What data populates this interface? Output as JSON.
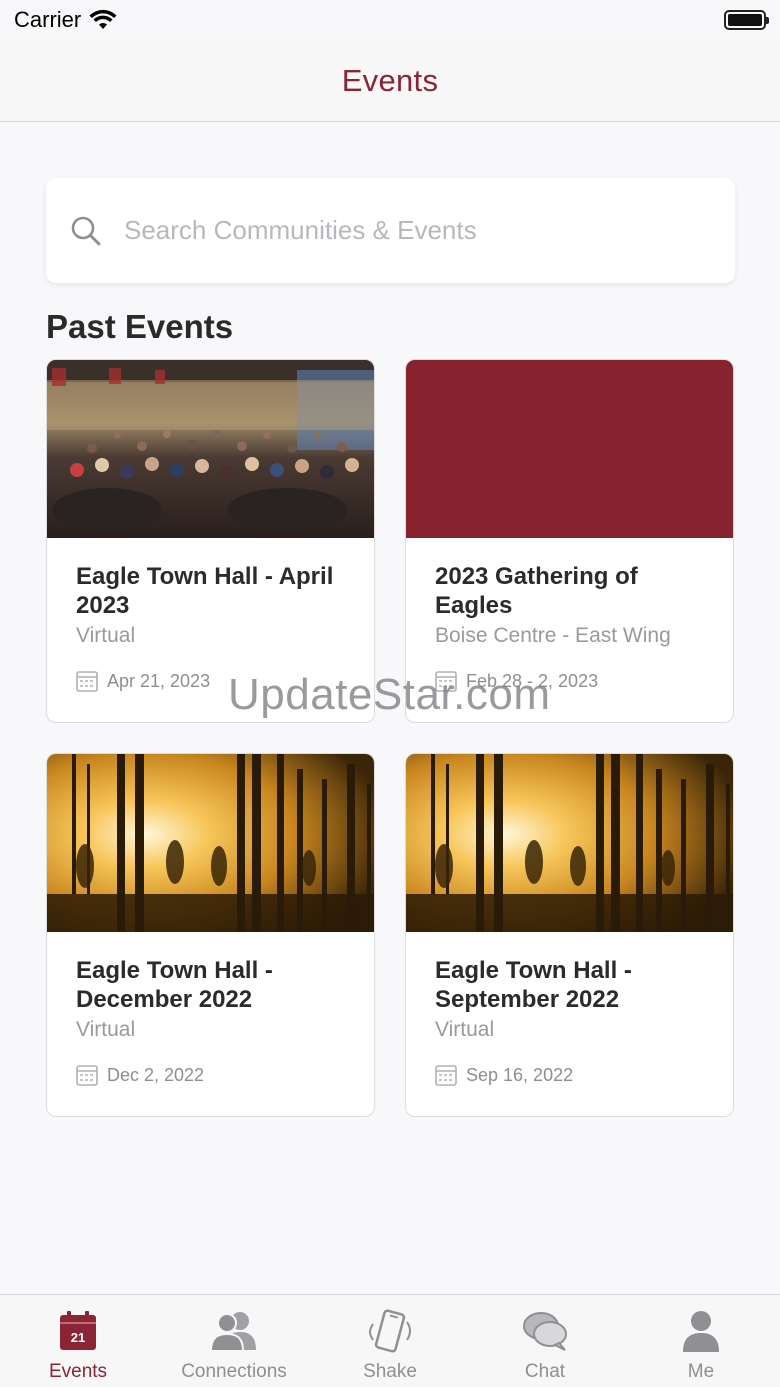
{
  "status_bar": {
    "carrier": "Carrier"
  },
  "nav": {
    "title": "Events"
  },
  "search": {
    "placeholder": "Search Communities & Events",
    "value": ""
  },
  "section": {
    "title": "Past Events"
  },
  "events": [
    {
      "title": "Eagle Town Hall - April 2023",
      "location": "Virtual",
      "date": "Apr 21, 2023",
      "image": "banquet-hall-photo"
    },
    {
      "title": "2023 Gathering of Eagles",
      "location": "Boise Centre - East Wing",
      "date": "Feb 28 - 2, 2023",
      "image": "solid-maroon-placeholder"
    },
    {
      "title": "Eagle Town Hall - December 2022",
      "location": "Virtual",
      "date": "Dec  2, 2022",
      "image": "sunset-power-poles-photo"
    },
    {
      "title": "Eagle Town Hall - September 2022",
      "location": "Virtual",
      "date": "Sep 16, 2022",
      "image": "sunset-power-poles-photo"
    }
  ],
  "watermark": "UpdateStar.com",
  "tabs": [
    {
      "label": "Events",
      "icon": "calendar-icon",
      "badge": "21",
      "active": true
    },
    {
      "label": "Connections",
      "icon": "people-icon",
      "active": false
    },
    {
      "label": "Shake",
      "icon": "shake-phone-icon",
      "active": false
    },
    {
      "label": "Chat",
      "icon": "chat-bubbles-icon",
      "active": false
    },
    {
      "label": "Me",
      "icon": "person-icon",
      "active": false
    }
  ],
  "colors": {
    "accent": "#8b2434",
    "inactive": "#8f8f94",
    "placeholder_card": "#86232f"
  }
}
